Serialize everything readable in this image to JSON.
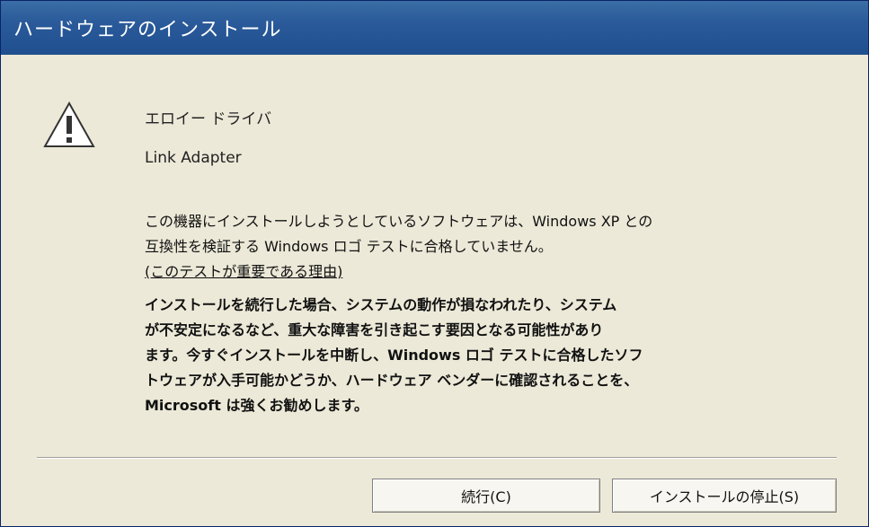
{
  "window": {
    "title": "ハードウェアのインストール"
  },
  "message": {
    "icon": "warning-icon",
    "device_name": "エロイー ドライバ",
    "device_sub": "Link Adapter",
    "paragraph1_lines": [
      "この機器にインストールしようとしているソフトウェアは、Windows XP との",
      "互換性を検証する Windows ロゴ テストに合格していません。",
      "(このテストが重要である理由)"
    ],
    "paragraph1_link": "(このテストが重要である理由)",
    "paragraph2_lines": [
      "インストールを続行した場合、システムの動作が損なわれたり、システム",
      "が不安定になるなど、重大な障害を引き起こす要因となる可能性があり",
      "ます。今すぐインストールを中断し、Windows ロゴ テストに合格したソフ",
      "トウェアが入手可能かどうか、ハードウェア ベンダーに確認されることを、",
      "Microsoft は強くお勧めします。"
    ]
  },
  "buttons": {
    "continue_label": "続行(C)",
    "stop_label": "インストールの停止(S)"
  }
}
